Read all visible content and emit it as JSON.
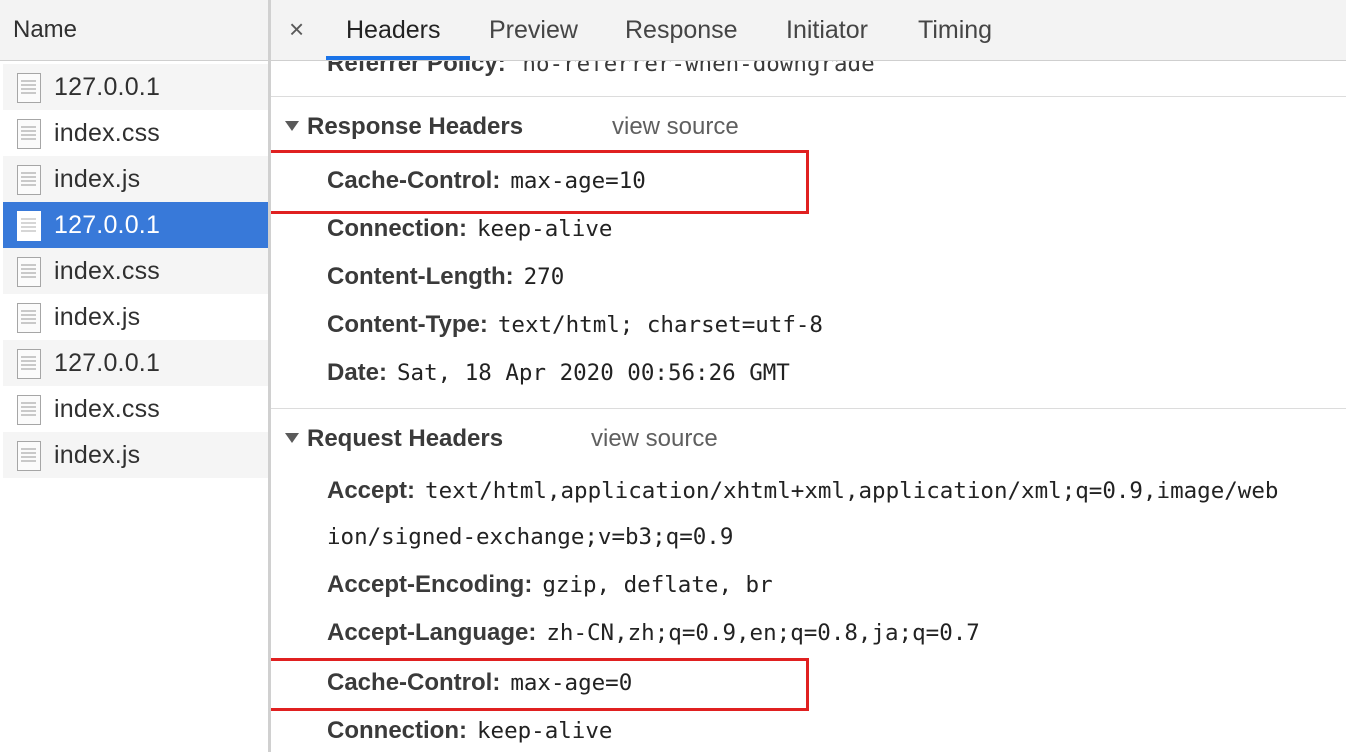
{
  "sidebar": {
    "header": "Name",
    "requests": [
      {
        "name": "127.0.0.1",
        "selected": false
      },
      {
        "name": "index.css",
        "selected": false
      },
      {
        "name": "index.js",
        "selected": false
      },
      {
        "name": "127.0.0.1",
        "selected": true
      },
      {
        "name": "index.css",
        "selected": false
      },
      {
        "name": "index.js",
        "selected": false
      },
      {
        "name": "127.0.0.1",
        "selected": false
      },
      {
        "name": "index.css",
        "selected": false
      },
      {
        "name": "index.js",
        "selected": false
      }
    ]
  },
  "tabs": {
    "close": "×",
    "items": [
      "Headers",
      "Preview",
      "Response",
      "Initiator",
      "Timing"
    ],
    "active": "Headers"
  },
  "general": {
    "partial_key": "Referrer Policy:",
    "partial_value": "no-referrer-when-downgrade"
  },
  "response_headers": {
    "title": "Response Headers",
    "view_source": "view source",
    "items": [
      {
        "key": "Cache-Control:",
        "value": "max-age=10"
      },
      {
        "key": "Connection:",
        "value": "keep-alive"
      },
      {
        "key": "Content-Length:",
        "value": "270"
      },
      {
        "key": "Content-Type:",
        "value": "text/html; charset=utf-8"
      },
      {
        "key": "Date:",
        "value": "Sat, 18 Apr 2020 00:56:26 GMT"
      }
    ]
  },
  "request_headers": {
    "title": "Request Headers",
    "view_source": "view source",
    "accept_key": "Accept:",
    "accept_value_line1": "text/html,application/xhtml+xml,application/xml;q=0.9,image/web",
    "accept_value_line2": "ion/signed-exchange;v=b3;q=0.9",
    "items": [
      {
        "key": "Accept-Encoding:",
        "value": "gzip, deflate, br"
      },
      {
        "key": "Accept-Language:",
        "value": "zh-CN,zh;q=0.9,en;q=0.8,ja;q=0.7"
      },
      {
        "key": "Cache-Control:",
        "value": "max-age=0"
      },
      {
        "key": "Connection:",
        "value": "keep-alive"
      }
    ]
  },
  "colors": {
    "selected_row": "#3879d9",
    "highlight": "#e02020",
    "tab_underline": "#1a73e8"
  }
}
